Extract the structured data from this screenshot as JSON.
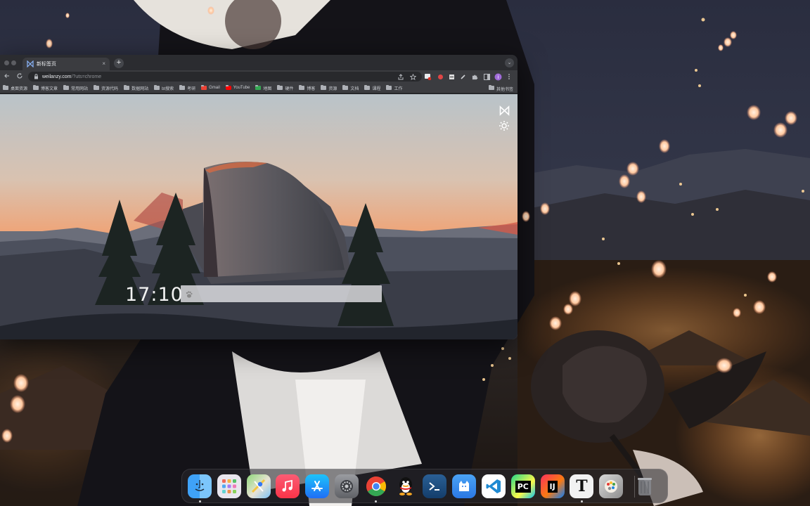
{
  "browser": {
    "tab": {
      "title": "新标签页",
      "close_glyph": "×"
    },
    "new_tab_glyph": "+",
    "tab_search_glyph": "⌄",
    "address_bar": {
      "host": "weilanzy.com",
      "path": "/?uts=chrome"
    },
    "bookmarks": [
      "桌面资源",
      "博客文章",
      "常用网站",
      "资源代码",
      "数据网站",
      "bt搜索",
      "考研",
      "Gmail",
      "YouTube",
      "地图",
      "硬件",
      "博客",
      "资源",
      "文档",
      "课程",
      "工作"
    ],
    "bookmarks_right": "其他书签",
    "icons": {
      "back": "back-arrow-icon",
      "reload": "reload-icon",
      "lock": "lock-icon",
      "share": "share-icon",
      "star": "bookmark-star-icon",
      "extension": "puzzle-icon",
      "menu": "kebab-menu-icon",
      "profile": "profile-avatar-icon"
    }
  },
  "newtab_page": {
    "clock": "17:10",
    "search_placeholder": "",
    "search_engine_icon": "baidu-paw-icon",
    "logo_icon": "bowtie-logo-icon",
    "settings_icon": "gear-icon"
  },
  "dock": {
    "apps": [
      {
        "name": "Finder",
        "icon": "finder-icon",
        "running": true
      },
      {
        "name": "Launchpad",
        "icon": "launchpad-icon",
        "running": false
      },
      {
        "name": "Maps",
        "icon": "maps-icon",
        "running": false
      },
      {
        "name": "Music",
        "icon": "music-icon",
        "running": false
      },
      {
        "name": "App Store",
        "icon": "app-store-icon",
        "running": false
      },
      {
        "name": "System Settings",
        "icon": "settings-icon",
        "running": false
      },
      {
        "name": "Chrome",
        "icon": "chrome-icon",
        "running": true
      },
      {
        "name": "QQ",
        "icon": "qq-penguin-icon",
        "running": false
      },
      {
        "name": "PowerShell",
        "icon": "terminal-icon",
        "running": false
      },
      {
        "name": "Tool",
        "icon": "cat-icon",
        "running": false
      },
      {
        "name": "VS Code",
        "icon": "vscode-icon",
        "running": false
      },
      {
        "name": "PyCharm",
        "icon": "pycharm-icon",
        "running": false,
        "label": "PC"
      },
      {
        "name": "IntelliJ IDEA",
        "icon": "intellij-icon",
        "running": false,
        "label": "IJ"
      },
      {
        "name": "Typora",
        "icon": "typora-icon",
        "running": true,
        "label": "T"
      },
      {
        "name": "Photo Tool",
        "icon": "photo-palette-icon",
        "running": false
      },
      {
        "name": "Trash",
        "icon": "trash-icon",
        "running": false
      }
    ]
  },
  "colors": {
    "window_chrome": "#3b3c40",
    "tabstrip": "#2b2c30",
    "sky_top": "#b9c3c9",
    "sky_glow": "#f2a070",
    "lantern": "#ffc9a0"
  }
}
